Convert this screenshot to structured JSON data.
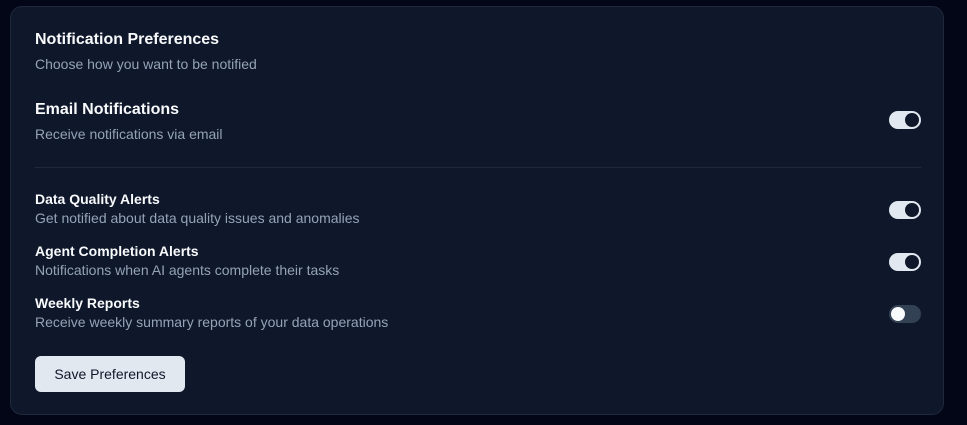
{
  "header": {
    "title": "Notification Preferences",
    "subtitle": "Choose how you want to be notified"
  },
  "email": {
    "title": "Email Notifications",
    "description": "Receive notifications via email",
    "enabled": true
  },
  "alerts": [
    {
      "title": "Data Quality Alerts",
      "description": "Get notified about data quality issues and anomalies",
      "enabled": true
    },
    {
      "title": "Agent Completion Alerts",
      "description": "Notifications when AI agents complete their tasks",
      "enabled": true
    },
    {
      "title": "Weekly Reports",
      "description": "Receive weekly summary reports of your data operations",
      "enabled": false
    }
  ],
  "actions": {
    "save_label": "Save Preferences"
  },
  "colors": {
    "page_background": "#020617",
    "card_background": "#0f172a",
    "toggle_on": "#e2e8f0",
    "toggle_off": "#334155",
    "primary_text": "#f8fafc",
    "muted_text": "#94a3b8"
  }
}
